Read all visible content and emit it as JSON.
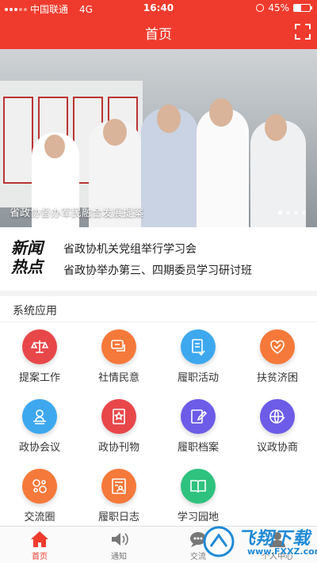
{
  "status_bar": {
    "carrier": "中国联通",
    "network": "4G",
    "time": "16:40",
    "battery": "45%",
    "battery_level": 0.45
  },
  "header": {
    "title": "首页",
    "scan_icon": "scan-icon"
  },
  "banner": {
    "caption": "省政协督办军民融合发展提案",
    "slides": 4,
    "active_slide": 0
  },
  "news": {
    "logo_line1": "新闻",
    "logo_line2": "热点",
    "items": [
      "省政协机关党组举行学习会",
      "省政协举办第三、四期委员学习研讨班"
    ]
  },
  "apps": {
    "title": "系统应用",
    "items": [
      {
        "label": "提案工作",
        "icon": "scales-icon",
        "color": "#e8474a"
      },
      {
        "label": "社情民意",
        "icon": "chat-icon",
        "color": "#f5793a"
      },
      {
        "label": "履职活动",
        "icon": "document-icon",
        "color": "#3ea8ef"
      },
      {
        "label": "扶贫济困",
        "icon": "heart-icon",
        "color": "#f5793a"
      },
      {
        "label": "政协会议",
        "icon": "meeting-icon",
        "color": "#3ea8ef"
      },
      {
        "label": "政协刊物",
        "icon": "magazine-icon",
        "color": "#e8474a"
      },
      {
        "label": "履职档案",
        "icon": "archive-icon",
        "color": "#6c5ce7"
      },
      {
        "label": "议政协商",
        "icon": "globe-icon",
        "color": "#6c5ce7"
      },
      {
        "label": "交流圈",
        "icon": "circles-icon",
        "color": "#f5793a"
      },
      {
        "label": "履职日志",
        "icon": "log-icon",
        "color": "#f5793a"
      },
      {
        "label": "学习园地",
        "icon": "book-icon",
        "color": "#2ec27e"
      }
    ]
  },
  "tabbar": {
    "items": [
      {
        "label": "首页",
        "icon": "home-icon"
      },
      {
        "label": "通知",
        "icon": "speaker-icon"
      },
      {
        "label": "交流",
        "icon": "chat-bubble-icon"
      },
      {
        "label": "个人中心",
        "icon": "person-icon"
      }
    ],
    "active": 0
  },
  "watermark": {
    "text": "飞翔下载",
    "url": "www.FXXZ.com"
  }
}
